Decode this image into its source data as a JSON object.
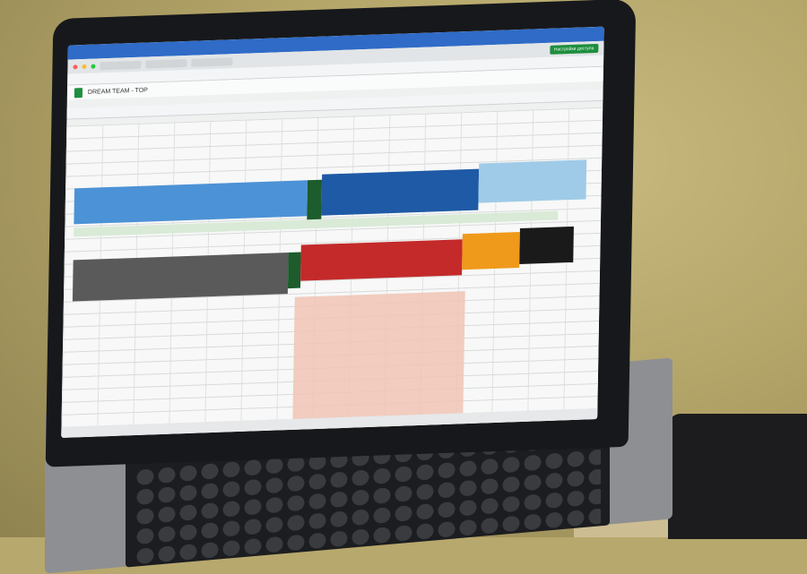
{
  "spreadsheet": {
    "title": "DREAM TEAM - TOP",
    "save_button": "Настройки доступа"
  },
  "colors": {
    "wall": "#b7a86d",
    "header_blue": "#4c92d6",
    "header_dark_blue": "#1f5aa6",
    "header_green": "#1d5c2c",
    "header_gray": "#5a5a5a",
    "header_red": "#c42a2a",
    "header_orange": "#ef9a1b",
    "highlight_pink": "#efc7b8",
    "sheets_green": "#1e8e3e"
  },
  "icons": [
    "sheets-icon",
    "traffic-light-icons",
    "share-button"
  ]
}
